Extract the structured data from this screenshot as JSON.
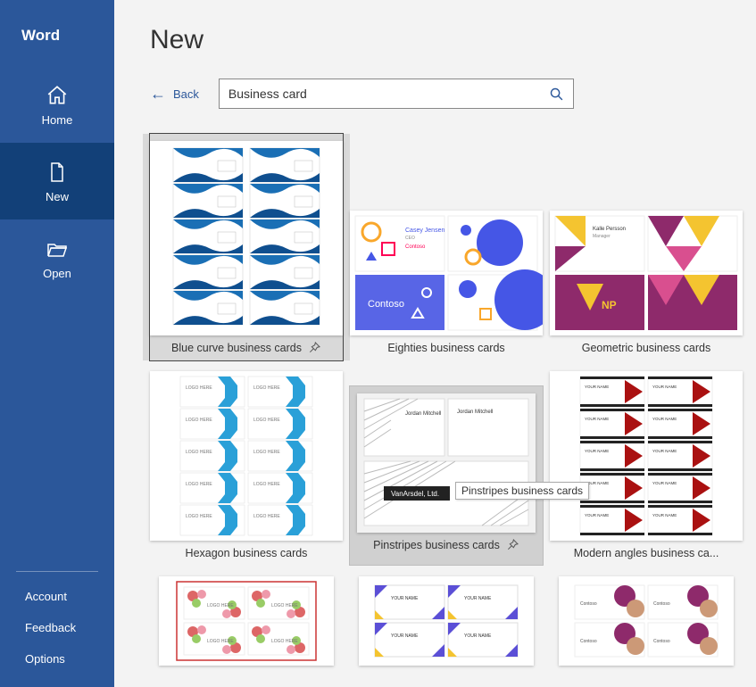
{
  "app_title": "Word",
  "brand": "Word",
  "sidebar": {
    "items": [
      {
        "label": "Home"
      },
      {
        "label": "New"
      },
      {
        "label": "Open"
      }
    ],
    "secondary": [
      {
        "label": "Account"
      },
      {
        "label": "Feedback"
      },
      {
        "label": "Options"
      }
    ]
  },
  "page": {
    "title": "New",
    "back_label": "Back"
  },
  "search": {
    "value": "Business card"
  },
  "templates": [
    {
      "label": "Blue curve business cards",
      "pinned_visible": true,
      "selected": true,
      "size": "first"
    },
    {
      "label": "Eighties business cards",
      "size": "std"
    },
    {
      "label": "Geometric business cards",
      "size": "std"
    },
    {
      "label": "Hexagon business cards",
      "size": "mid"
    },
    {
      "label": "Pinstripes business cards",
      "pinned_visible": true,
      "hover": true,
      "size": "mid",
      "tooltip": "Pinstripes business cards"
    },
    {
      "label": "Modern angles business ca...",
      "size": "mid"
    },
    {
      "label": "",
      "size": "part"
    },
    {
      "label": "",
      "size": "part"
    },
    {
      "label": "",
      "size": "part"
    }
  ],
  "preview_text": {
    "contoso": "Contoso",
    "casey": "Casey Jensen",
    "ceo": "CEO",
    "kalle": "Kalle Persson",
    "manager": "Manager",
    "np": "NP",
    "logo_here": "LOGO HERE",
    "jordan": "Jordan Mitchell",
    "van": "VanArsdel, Ltd.",
    "your_name": "YOUR NAME"
  }
}
